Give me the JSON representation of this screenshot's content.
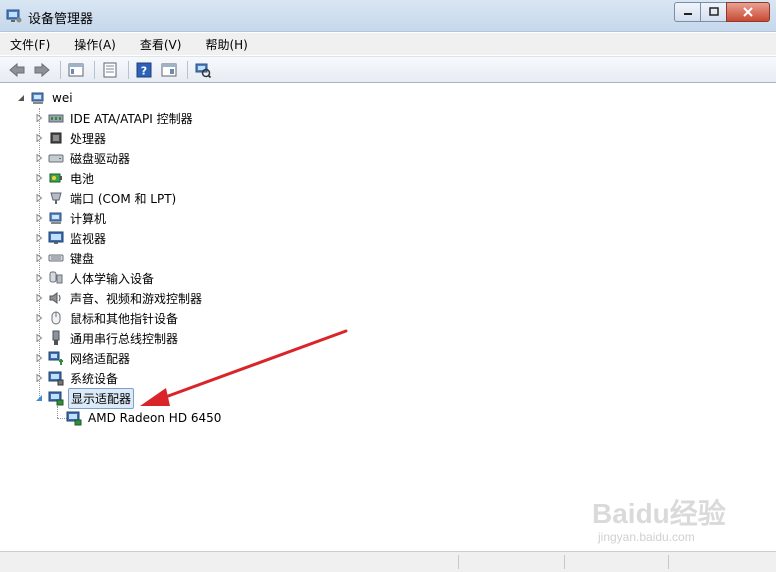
{
  "window": {
    "title": "设备管理器"
  },
  "menu": {
    "items": [
      {
        "label": "文件(F)"
      },
      {
        "label": "操作(A)"
      },
      {
        "label": "查看(V)"
      },
      {
        "label": "帮助(H)"
      }
    ]
  },
  "tree": {
    "root": {
      "label": "wei",
      "icon": "computer-icon"
    },
    "items": [
      {
        "label": "IDE ATA/ATAPI 控制器",
        "icon": "ide-controller-icon"
      },
      {
        "label": "处理器",
        "icon": "processor-icon"
      },
      {
        "label": "磁盘驱动器",
        "icon": "disk-drive-icon"
      },
      {
        "label": "电池",
        "icon": "battery-icon"
      },
      {
        "label": "端口 (COM 和 LPT)",
        "icon": "port-icon"
      },
      {
        "label": "计算机",
        "icon": "computer-icon"
      },
      {
        "label": "监视器",
        "icon": "monitor-icon"
      },
      {
        "label": "键盘",
        "icon": "keyboard-icon"
      },
      {
        "label": "人体学输入设备",
        "icon": "hid-icon"
      },
      {
        "label": "声音、视频和游戏控制器",
        "icon": "sound-icon"
      },
      {
        "label": "鼠标和其他指针设备",
        "icon": "mouse-icon"
      },
      {
        "label": "通用串行总线控制器",
        "icon": "usb-icon"
      },
      {
        "label": "网络适配器",
        "icon": "network-adapter-icon"
      },
      {
        "label": "系统设备",
        "icon": "system-device-icon"
      },
      {
        "label": "显示适配器",
        "icon": "display-adapter-icon",
        "expanded": true,
        "selected": true
      }
    ],
    "child": {
      "label": "AMD Radeon HD 6450",
      "icon": "display-adapter-icon"
    }
  },
  "watermark": {
    "text": "Baidu经验",
    "sub": "jingyan.baidu.com"
  },
  "colors": {
    "annotation_arrow": "#d9252a",
    "selection_bg": "#dce9f7",
    "selection_border": "#7da2ce"
  }
}
